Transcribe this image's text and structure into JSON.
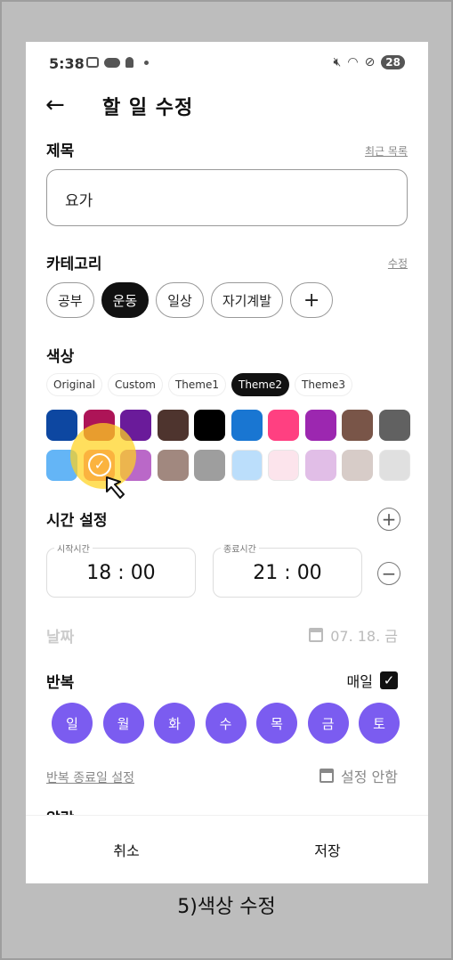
{
  "status": {
    "time": "5:38",
    "battery": "28",
    "icons": [
      "screenshot-icon",
      "pill-icon",
      "bulb-icon",
      "dot-icon",
      "mute-icon",
      "wifi-icon",
      "dnd-icon"
    ]
  },
  "header": {
    "back": "←",
    "title": "할 일 수정"
  },
  "title_section": {
    "label": "제목",
    "link": "최근 목록",
    "value": "요가"
  },
  "category": {
    "label": "카테고리",
    "link": "수정",
    "items": [
      "공부",
      "운동",
      "일상",
      "자기계발"
    ],
    "selected": "운동",
    "add": "+"
  },
  "color": {
    "label": "색상",
    "themes": [
      "Original",
      "Custom",
      "Theme1",
      "Theme2",
      "Theme3"
    ],
    "selected_theme": "Theme2",
    "swatches": [
      "#0d47a1",
      "#ad1457",
      "#6a1b9a",
      "#4e342e",
      "#000000",
      "#1976d2",
      "#ff4081",
      "#9c27b0",
      "#795548",
      "#616161",
      "#64b5f6",
      "#f06292",
      "#ba68c8",
      "#a1887f",
      "#9e9e9e",
      "#bbdefb",
      "#fce4ec",
      "#e1bee7",
      "#d7ccc8",
      "#e0e0e0"
    ],
    "selected_index": 11,
    "check": "✓",
    "highlight_color": "#ffd21e"
  },
  "time": {
    "label": "시간 설정",
    "add": "+",
    "remove": "−",
    "start_caption": "시작시간",
    "start": "18 : 00",
    "end_caption": "종료시간",
    "end": "21 : 00"
  },
  "date": {
    "label": "날짜",
    "value": "07. 18. 금"
  },
  "repeat": {
    "label": "반복",
    "daily": "매일",
    "checked": "✓",
    "days": [
      "일",
      "월",
      "화",
      "수",
      "목",
      "금",
      "토"
    ],
    "day_color": "#7b5cf0",
    "end_link": "반복 종료일 설정",
    "end_value": "설정 안함"
  },
  "alarm": {
    "label": "알람"
  },
  "footer": {
    "cancel": "취소",
    "save": "저장"
  },
  "caption": "5)색상 수정"
}
